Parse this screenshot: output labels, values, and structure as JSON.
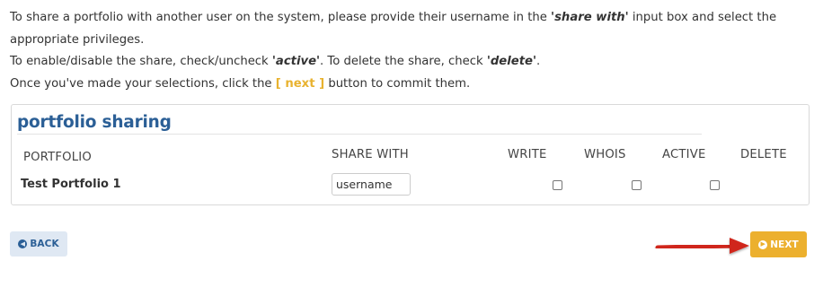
{
  "instructions": {
    "line1_a": "To share a portfolio with another user on the system, please provide their username in the ",
    "line1_em": "'share with'",
    "line1_b": " input box and select the appropriate privileges.",
    "line2_a": "To enable/disable the share, check/uncheck ",
    "line2_em1": "'active'",
    "line2_b": ". To delete the share, check ",
    "line2_em2": "'delete'",
    "line2_c": ".",
    "line3_a": "Once you've made your selections, click the ",
    "line3_next": "[ next ]",
    "line3_b": " button to commit them."
  },
  "panel": {
    "title": "portfolio sharing",
    "columns": {
      "portfolio": "PORTFOLIO",
      "share_with": "SHARE WITH",
      "write": "WRITE",
      "whois": "WHOIS",
      "active": "ACTIVE",
      "delete": "DELETE"
    },
    "rows": [
      {
        "portfolio": "Test Portfolio 1",
        "share_with_value": "username",
        "write": false,
        "whois": false,
        "active": false
      }
    ]
  },
  "buttons": {
    "back_label": "BACK",
    "next_label": "NEXT"
  },
  "colors": {
    "accent_blue": "#2b5f96",
    "next_yellow": "#ecb02e",
    "arrow_red": "#d0281c"
  },
  "icons": {
    "back": "circle-arrow-left-icon",
    "next": "circle-arrow-right-icon",
    "pointer": "red-arrow-pointer-icon"
  }
}
